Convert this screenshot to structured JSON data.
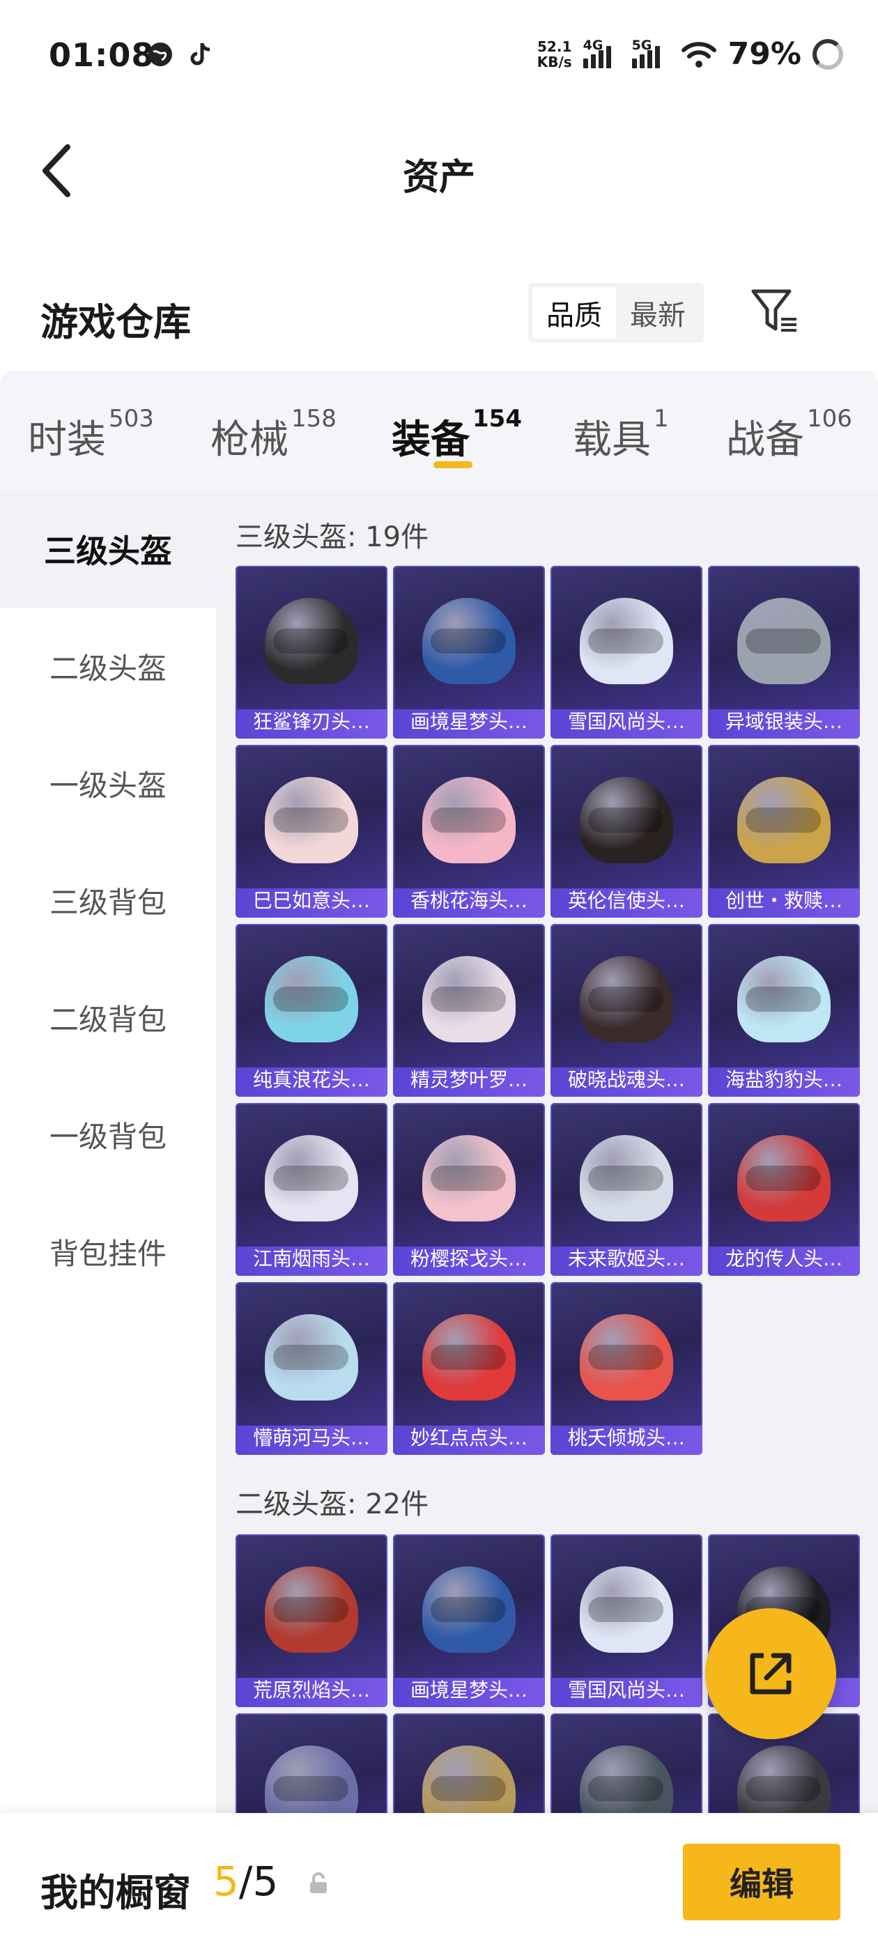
{
  "status_bar": {
    "time": "01:08",
    "net_speed_value": "52.1",
    "net_speed_unit": "KB/s",
    "signal_1_label": "4G",
    "signal_2_label": "5G",
    "battery": "79%"
  },
  "header": {
    "title": "资产"
  },
  "warehouse": {
    "title": "游戏仓库",
    "sort_options": [
      "品质",
      "最新"
    ],
    "active_sort": "品质"
  },
  "tabs": [
    {
      "label": "时装",
      "count": "503"
    },
    {
      "label": "枪械",
      "count": "158"
    },
    {
      "label": "装备",
      "count": "154"
    },
    {
      "label": "载具",
      "count": "1"
    },
    {
      "label": "战备",
      "count": "106"
    }
  ],
  "active_tab": "装备",
  "sidebar": {
    "items": [
      "三级头盔",
      "二级头盔",
      "一级头盔",
      "三级背包",
      "二级背包",
      "一级背包",
      "背包挂件"
    ],
    "active": "三级头盔"
  },
  "sections": [
    {
      "title": "三级头盔: 19件",
      "items": [
        {
          "name": "狂鲨锋刃头…",
          "color": "#2b2b2b"
        },
        {
          "name": "画境星梦头…",
          "color": "#2f5aa8"
        },
        {
          "name": "雪国风尚头…",
          "color": "#dfe6f5"
        },
        {
          "name": "异域银装头…",
          "color": "#9aa3ad"
        },
        {
          "name": "巳巳如意头…",
          "color": "#f3d7d9"
        },
        {
          "name": "香桃花海头…",
          "color": "#f5b7c8"
        },
        {
          "name": "英伦信使头…",
          "color": "#2a2220"
        },
        {
          "name": "创世・救赎…",
          "color": "#caa34a"
        },
        {
          "name": "纯真浪花头…",
          "color": "#7fd3e6"
        },
        {
          "name": "精灵梦叶罗…",
          "color": "#eadde8"
        },
        {
          "name": "破晓战魂头…",
          "color": "#3a2a2c"
        },
        {
          "name": "海盐豹豹头…",
          "color": "#bfe6f5"
        },
        {
          "name": "江南烟雨头…",
          "color": "#e8e3f2"
        },
        {
          "name": "粉樱探戈头…",
          "color": "#f4c2cc"
        },
        {
          "name": "未来歌姬头…",
          "color": "#d6dde8"
        },
        {
          "name": "龙的传人头…",
          "color": "#d33a3a"
        },
        {
          "name": "懵萌河马头…",
          "color": "#b9dcef"
        },
        {
          "name": "妙红点点头…",
          "color": "#e03a3a"
        },
        {
          "name": "桃夭倾城头…",
          "color": "#e8544c"
        }
      ]
    },
    {
      "title": "二级头盔: 22件",
      "items": [
        {
          "name": "荒原烈焰头…",
          "color": "#b23a2e"
        },
        {
          "name": "画境星梦头…",
          "color": "#2f5aa8"
        },
        {
          "name": "雪国风尚头…",
          "color": "#dfe6f5"
        },
        {
          "name": "",
          "color": "#1e1e22"
        },
        {
          "name": "",
          "color": "#6b6ea8"
        },
        {
          "name": "",
          "color": "#b89a5a"
        },
        {
          "name": "",
          "color": "#4a5560"
        },
        {
          "name": "",
          "color": "#3a3a40"
        }
      ]
    }
  ],
  "showcase": {
    "label": "我的橱窗",
    "current": "5",
    "total": "5",
    "edit_label": "编辑"
  },
  "colors": {
    "accent": "#f5b71a",
    "card_bg": "#2a2456",
    "card_label_bg": "#6a4fe0"
  }
}
